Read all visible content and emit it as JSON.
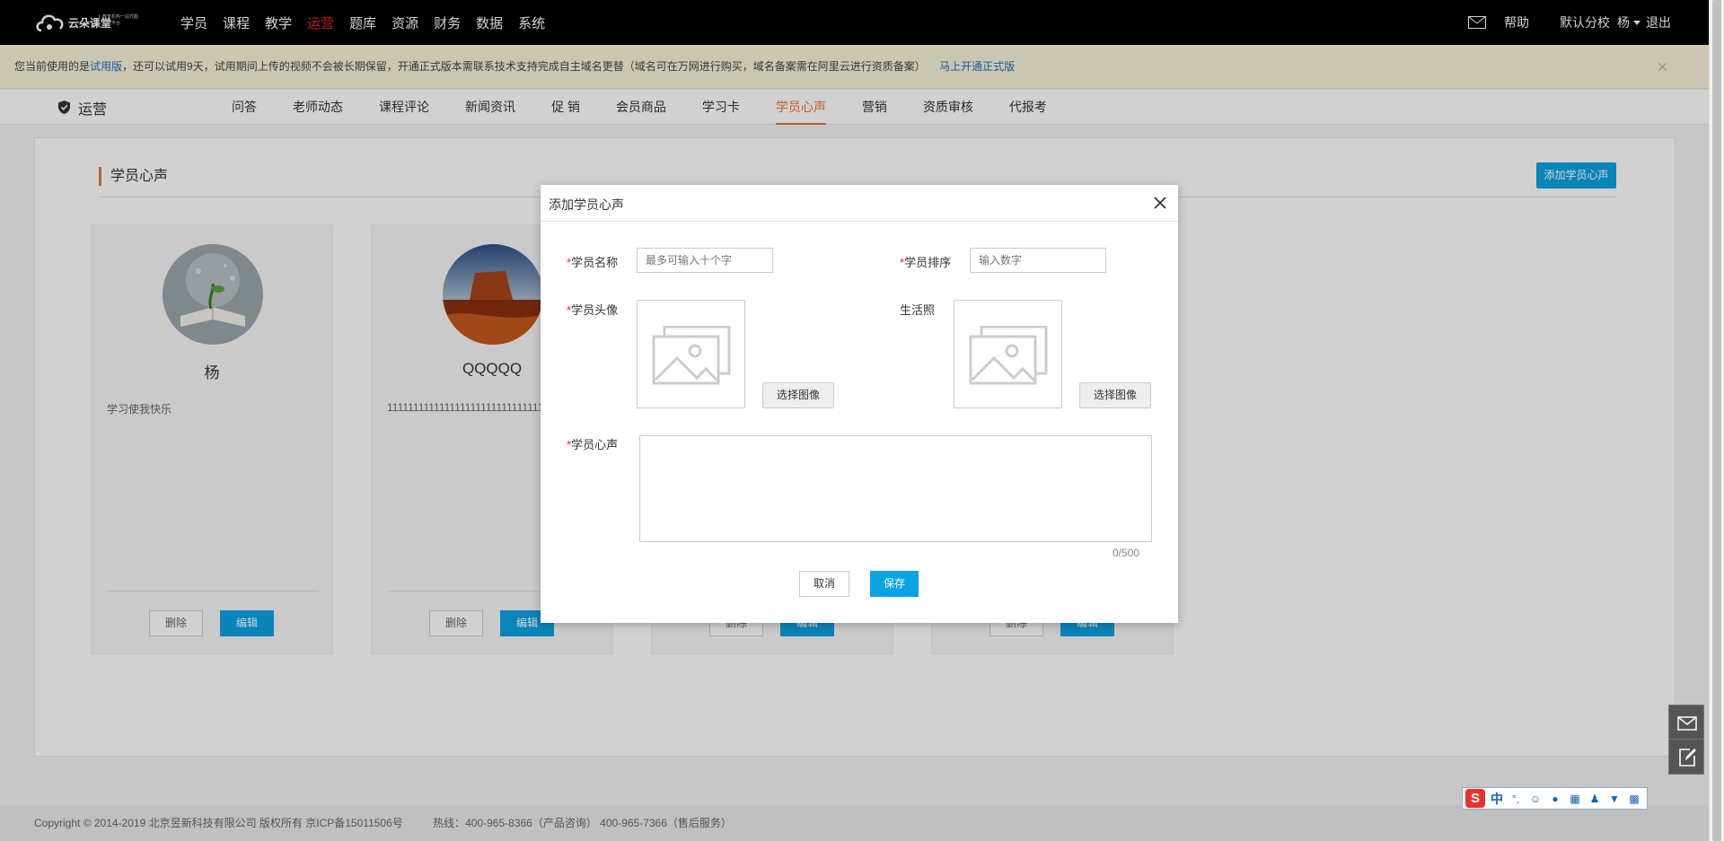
{
  "brand": {
    "name": "云朵课堂",
    "tagline": "教育机构一站式服务云平台"
  },
  "topnav": {
    "items": [
      "学员",
      "课程",
      "教学",
      "运营",
      "题库",
      "资源",
      "财务",
      "数据",
      "系统"
    ],
    "active": "运营"
  },
  "topright": {
    "help": "帮助",
    "school": "默认分校",
    "user": "杨",
    "logout": "退出"
  },
  "notice": {
    "prefix": "您当前使用的是",
    "trial_link": "试用版",
    "body": "，还可以试用9天，试用期间上传的视频不会被长期保留，开通正式版本需联系技术支持完成自主域名更替（域名可在万网进行购买，域名备案需在阿里云进行资质备案）",
    "open_link": "马上开通正式版",
    "close": "×"
  },
  "subnav": {
    "section": "运营",
    "tabs": [
      "问答",
      "老师动态",
      "课程评论",
      "新闻资讯",
      "促 销",
      "会员商品",
      "学习卡",
      "学员心声",
      "营销",
      "资质审核",
      "代报考"
    ],
    "active": "学员心声"
  },
  "page": {
    "title": "学员心声",
    "add_button": "添加学员心声"
  },
  "cards": [
    {
      "name": "杨",
      "desc": "学习使我快乐",
      "delete": "删除",
      "edit": "编辑"
    },
    {
      "name": "QQQQQ",
      "desc": "1111111111111111111111111111111",
      "delete": "删除",
      "edit": "编辑"
    },
    {
      "name": "",
      "desc": "",
      "delete": "删除",
      "edit": "编辑"
    },
    {
      "name": "",
      "desc": "",
      "delete": "删除",
      "edit": "编辑"
    }
  ],
  "modal": {
    "title": "添加学员心声",
    "name_label": "学员名称",
    "name_placeholder": "最多可输入十个字",
    "order_label": "学员排序",
    "order_placeholder": "输入数字",
    "avatar_label": "学员头像",
    "life_photo_label": "生活照",
    "pick_image": "选择图像",
    "voice_label": "学员心声",
    "counter": "0/500",
    "cancel": "取消",
    "save": "保存"
  },
  "footer": {
    "copyright": "Copyright © 2014-2019 北京昱新科技有限公司 版权所有 京ICP备15011506号",
    "hotline": "热线：400-965-8366（产品咨询） 400-965-7366（售后服务）"
  },
  "ime": {
    "mode": "中",
    "punct": "°,"
  },
  "colors": {
    "accent": "#0ba3e3",
    "orange": "#e8762f",
    "red": "#e8261f"
  }
}
